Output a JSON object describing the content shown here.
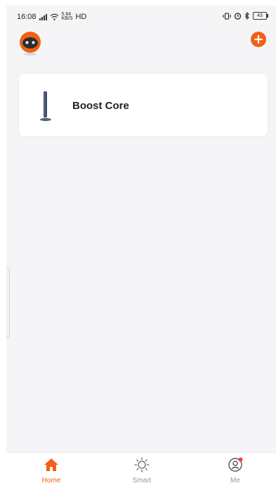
{
  "status_bar": {
    "time": "16:08",
    "network_speed_top": "5.64",
    "network_speed_bottom": "KB/S",
    "hd": "HD",
    "battery": "43"
  },
  "device": {
    "name": "Boost Core"
  },
  "nav": {
    "home_label": "Home",
    "smart_label": "Smart",
    "me_label": "Me"
  },
  "colors": {
    "accent": "#f26018",
    "background": "#f5f5f7"
  }
}
